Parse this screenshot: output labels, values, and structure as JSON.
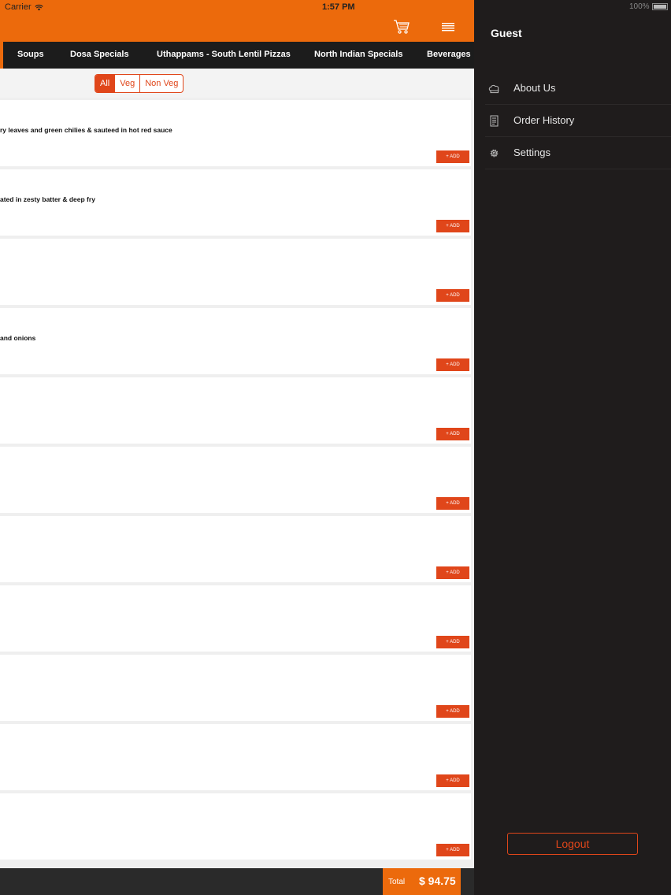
{
  "status": {
    "carrier": "Carrier",
    "time": "1:57 PM",
    "battery": "100%"
  },
  "header": {
    "cart_icon": "cart-icon",
    "menu_icon": "hamburger-icon"
  },
  "categories": [
    "Soups",
    "Dosa Specials",
    "Uthappams - South Lentil Pizzas",
    "North Indian Specials",
    "Beverages"
  ],
  "filter": {
    "options": [
      "All",
      "Veg",
      "Non Veg"
    ],
    "selected": "All"
  },
  "items": [
    {
      "desc": "ry leaves and green chilies & sauteed in hot red sauce",
      "add": "+ ADD"
    },
    {
      "desc": "ated in zesty batter & deep fry",
      "add": "+ ADD"
    },
    {
      "desc": "",
      "add": "+ ADD"
    },
    {
      "desc": "and onions",
      "add": "+ ADD"
    },
    {
      "desc": "",
      "add": "+ ADD"
    },
    {
      "desc": "",
      "add": "+ ADD"
    },
    {
      "desc": "",
      "add": "+ ADD"
    },
    {
      "desc": "",
      "add": "+ ADD"
    },
    {
      "desc": "",
      "add": "+ ADD"
    },
    {
      "desc": "",
      "add": "+ ADD"
    },
    {
      "desc": "",
      "add": "+ ADD"
    }
  ],
  "footer": {
    "total_label": "Total",
    "total_value": "$ 94.75"
  },
  "drawer": {
    "user": "Guest",
    "nav": [
      {
        "label": "About Us",
        "icon": "chef-hat-icon"
      },
      {
        "label": "Order History",
        "icon": "receipt-icon"
      },
      {
        "label": "Settings",
        "icon": "gear-icon"
      }
    ],
    "logout": "Logout"
  },
  "colors": {
    "brand": "#ec6a0c",
    "accent": "#e0461a",
    "drawer": "#1f1c1c",
    "category_bar": "#1c1c1c"
  }
}
